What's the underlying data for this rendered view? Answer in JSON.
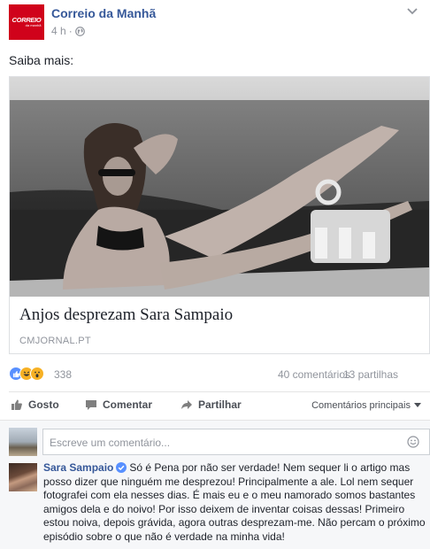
{
  "post": {
    "page_name": "Correio da Manhã",
    "logo_text": "CORREIO",
    "logo_sub": "da manhã",
    "time": "4 h",
    "separator": "·",
    "text": "Saiba mais:"
  },
  "link": {
    "title": "Anjos desprezam Sara Sampaio",
    "domain": "CMJORNAL.PT"
  },
  "stats": {
    "reaction_count": "338",
    "comments": "40 comentários",
    "shares": "13 partilhas"
  },
  "actions": {
    "like": "Gosto",
    "comment": "Comentar",
    "share": "Partilhar",
    "sort": "Comentários principais"
  },
  "composer": {
    "placeholder": "Escreve um comentário..."
  },
  "comment": {
    "author": "Sara Sampaio",
    "text": "Só é Pena por não ser verdade! Nem sequer li o artigo mas posso dizer que ninguém me desprezou! Principalmente a ale. Lol nem sequer fotografei com ela nesses dias. É mais eu e o meu namorado somos bastantes amigos dela e do noivo! Por isso deixem de inventar coisas dessas! Primeiro estou noiva, depois grávida, agora outras desprezam-me. Não percam o próximo episódio sobre o que não é verdade na minha vida!"
  },
  "colors": {
    "link_blue": "#365899",
    "brand_red": "#d0021b",
    "muted": "#90949c"
  }
}
